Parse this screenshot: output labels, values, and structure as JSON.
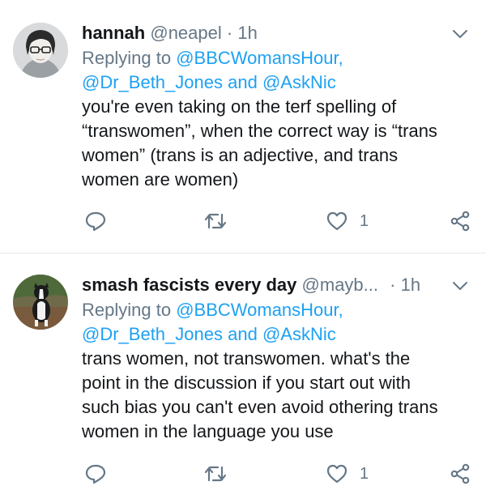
{
  "tweets": [
    {
      "name": "hannah",
      "handle": "@neapel",
      "dot": "·",
      "time": "1h",
      "replying_prefix": "Replying to",
      "reply_mention_1": "@BBCWomansHour,",
      "reply_mention_2": "@Dr_Beth_Jones",
      "reply_and": "and",
      "reply_mention_3": "@AskNic",
      "body_lines": [
        "you're even taking on the terf spelling of",
        "“transwomen”, when the correct way is “trans",
        "women” (trans is an adjective, and trans",
        "women are women)"
      ],
      "like_count": "1"
    },
    {
      "name": "smash fascists every day",
      "handle": "@mayb...",
      "dot": "·",
      "time": "1h",
      "replying_prefix": "Replying to",
      "reply_mention_1": "@BBCWomansHour,",
      "reply_mention_2": "@Dr_Beth_Jones",
      "reply_and": "and",
      "reply_mention_3": "@AskNic",
      "body_lines": [
        "trans women, not transwomen. what's the",
        "point in the discussion if you start out with",
        "such bias you can't even avoid othering trans",
        "women in the language you use"
      ],
      "like_count": "1"
    }
  ],
  "icons": {
    "reply": "reply-icon",
    "retweet": "retweet-icon",
    "like": "heart-icon",
    "share": "share-icon",
    "menu": "chevron-down-icon"
  },
  "colors": {
    "link": "#1da1f2",
    "secondary": "#657786",
    "divider": "#e6ecf0"
  }
}
